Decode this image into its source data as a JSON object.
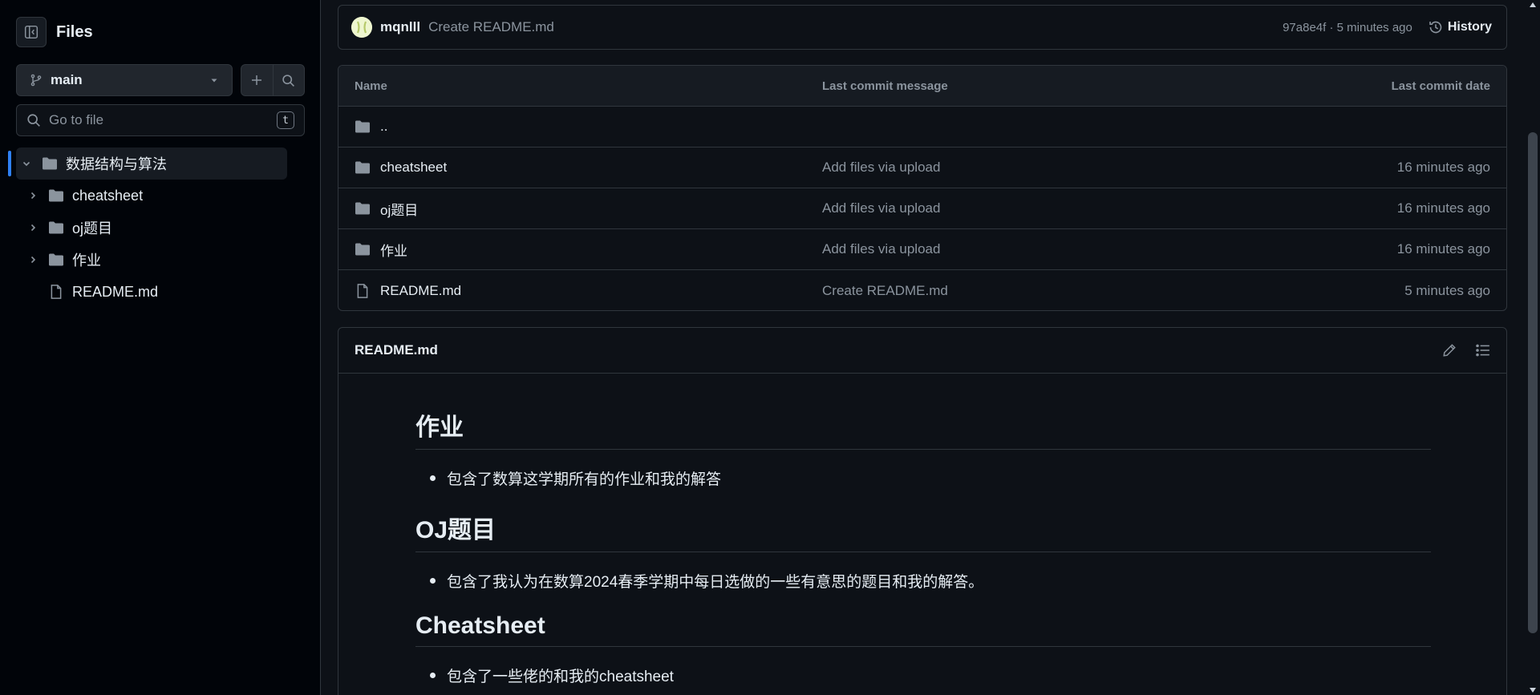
{
  "sidebar": {
    "title": "Files",
    "branch": "main",
    "search_placeholder": "Go to file",
    "search_shortcut": "t",
    "tree": {
      "root": "数据结构与算法",
      "children": [
        {
          "label": "cheatsheet",
          "type": "folder"
        },
        {
          "label": "oj题目",
          "type": "folder"
        },
        {
          "label": "作业",
          "type": "folder"
        },
        {
          "label": "README.md",
          "type": "file"
        }
      ]
    }
  },
  "commit": {
    "author": "mqnlll",
    "message": "Create README.md",
    "meta": "97a8e4f · 5 minutes ago",
    "history_label": "History"
  },
  "files": {
    "headers": {
      "name": "Name",
      "message": "Last commit message",
      "date": "Last commit date"
    },
    "rows": [
      {
        "name": "..",
        "message": "",
        "date": "",
        "type": "folder"
      },
      {
        "name": "cheatsheet",
        "message": "Add files via upload",
        "date": "16 minutes ago",
        "type": "folder"
      },
      {
        "name": "oj题目",
        "message": "Add files via upload",
        "date": "16 minutes ago",
        "type": "folder"
      },
      {
        "name": "作业",
        "message": "Add files via upload",
        "date": "16 minutes ago",
        "type": "folder"
      },
      {
        "name": "README.md",
        "message": "Create README.md",
        "date": "5 minutes ago",
        "type": "file"
      }
    ]
  },
  "readme": {
    "title": "README.md",
    "sections": [
      {
        "heading": "作业",
        "item": "包含了数算这学期所有的作业和我的解答"
      },
      {
        "heading": "OJ题目",
        "item": "包含了我认为在数算2024春季学期中每日选做的一些有意思的题目和我的解答。"
      },
      {
        "heading": "Cheatsheet",
        "item": "包含了一些佬的和我的cheatsheet"
      }
    ]
  },
  "colors": {
    "background": "#0d1117",
    "sidebar_bg": "#010409",
    "border": "#30363d",
    "accent": "#2f81f7",
    "muted_text": "#8b949e"
  }
}
